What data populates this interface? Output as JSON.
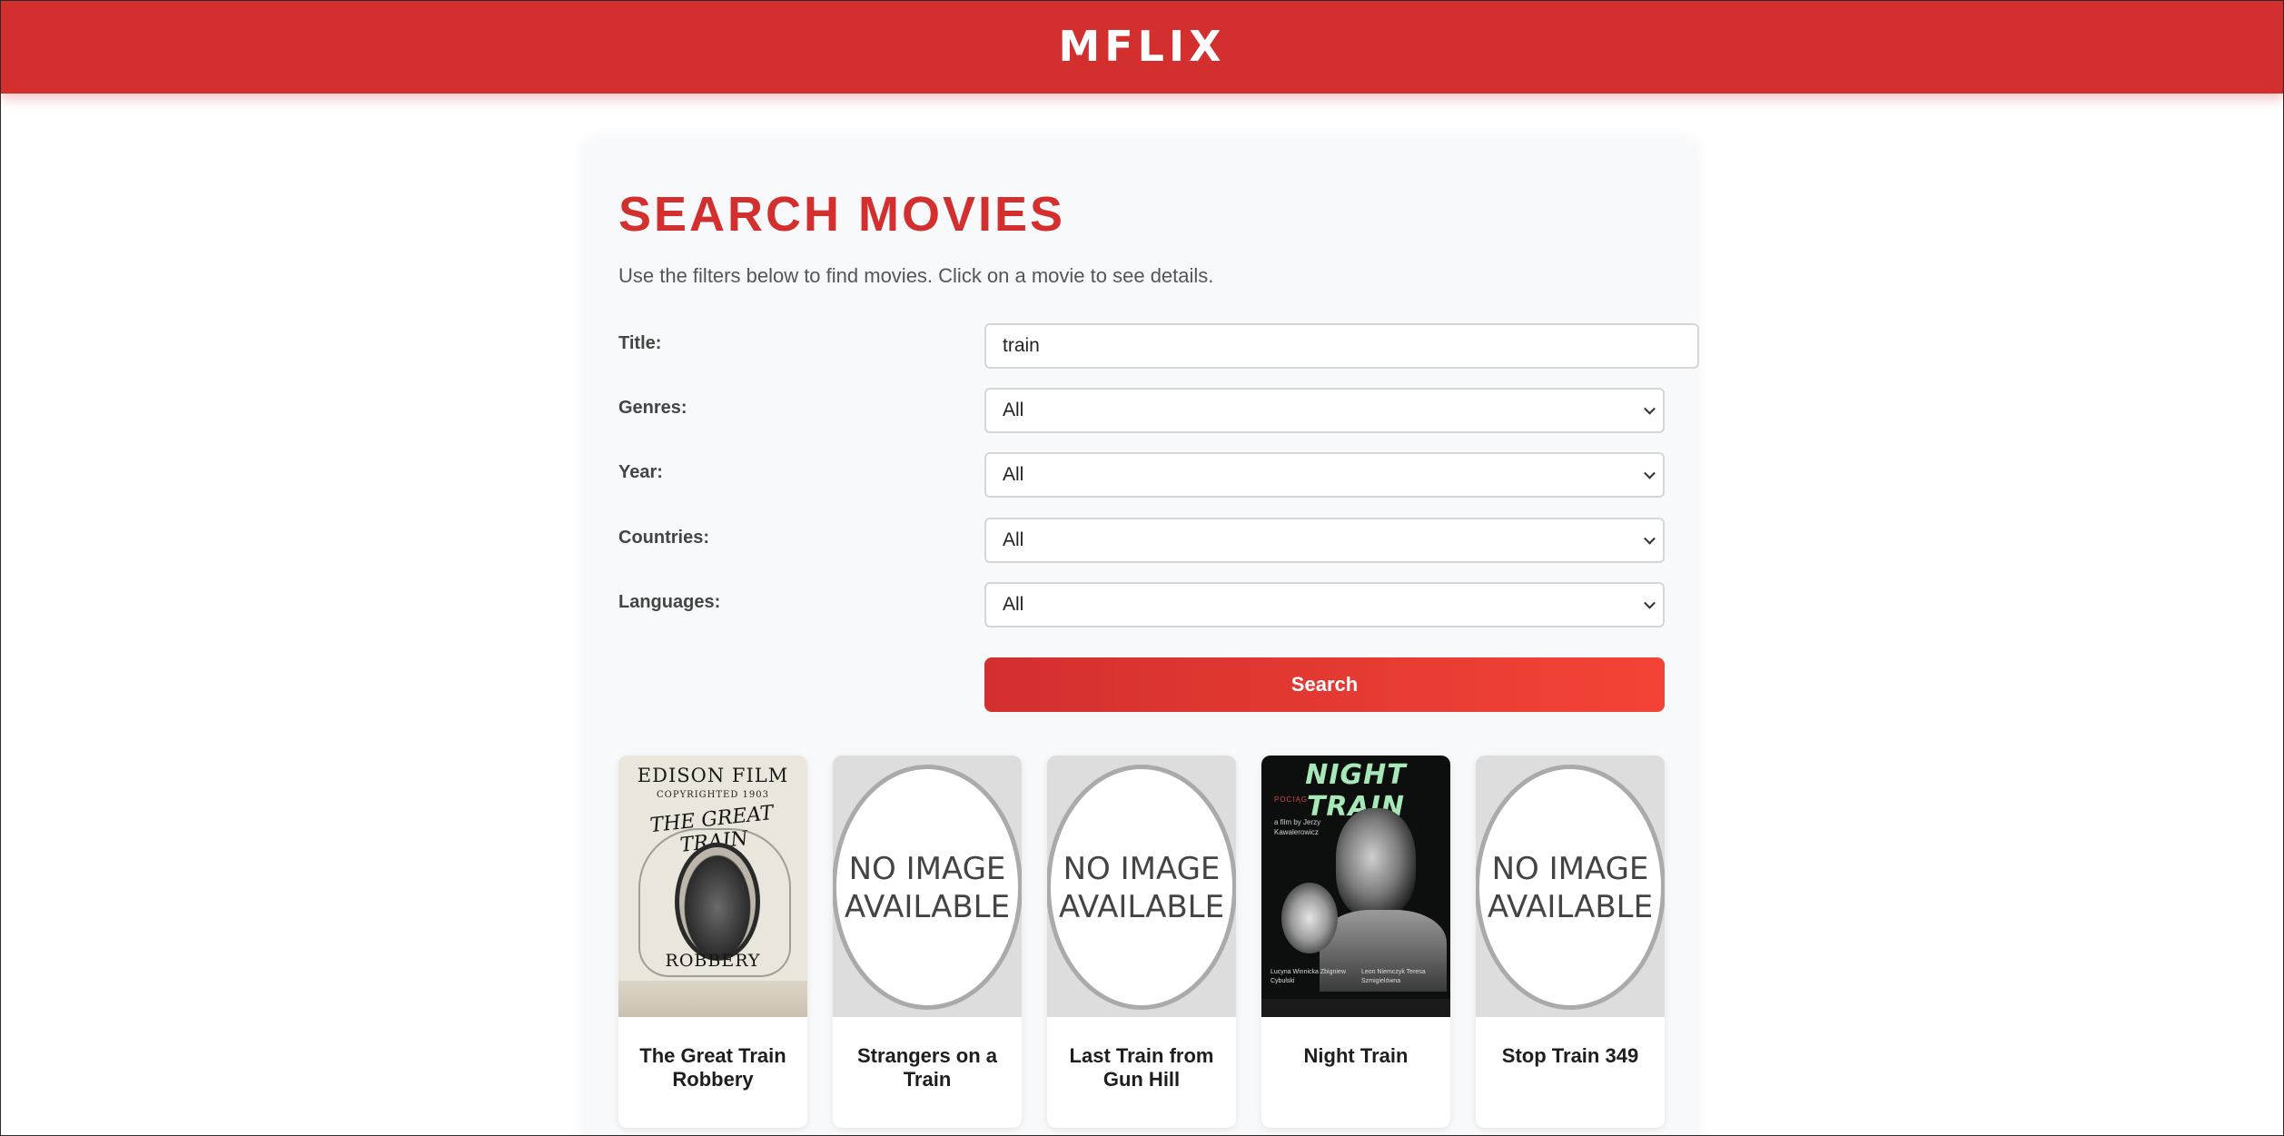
{
  "header": {
    "logo": "MFLIX"
  },
  "search": {
    "title": "SEARCH MOVIES",
    "subtitle": "Use the filters below to find movies. Click on a movie to see details.",
    "fields": {
      "title": {
        "label": "Title:",
        "value": "train"
      },
      "genres": {
        "label": "Genres:",
        "value": "All"
      },
      "year": {
        "label": "Year:",
        "value": "All"
      },
      "countries": {
        "label": "Countries:",
        "value": "All"
      },
      "languages": {
        "label": "Languages:",
        "value": "All"
      }
    },
    "button_label": "Search"
  },
  "colors": {
    "brand": "#d32f2f",
    "button_gradient_end": "#f44336",
    "panel_bg": "#f8f9fa"
  },
  "results": [
    {
      "title": "The Great Train Robbery",
      "poster": {
        "type": "image",
        "lines": [
          "EDISON FILM",
          "COPYRIGHTED 1903",
          "THE GREAT TRAIN",
          "ROBBERY"
        ]
      }
    },
    {
      "title": "Strangers on a Train",
      "poster": {
        "type": "placeholder",
        "text": "NO IMAGE AVAILABLE"
      }
    },
    {
      "title": "Last Train from Gun Hill",
      "poster": {
        "type": "placeholder",
        "text": "NO IMAGE AVAILABLE"
      }
    },
    {
      "title": "Night Train",
      "poster": {
        "type": "image",
        "lines": [
          "NIGHT TRAIN",
          "POCIĄG",
          "a film by Jerzy Kawalerowicz",
          "Lucyna Winnicka  Zbigniew Cybulski",
          "Leon Niemczyk  Teresa Szmigielówna"
        ]
      }
    },
    {
      "title": "Stop Train 349",
      "poster": {
        "type": "placeholder",
        "text": "NO IMAGE AVAILABLE"
      }
    }
  ]
}
